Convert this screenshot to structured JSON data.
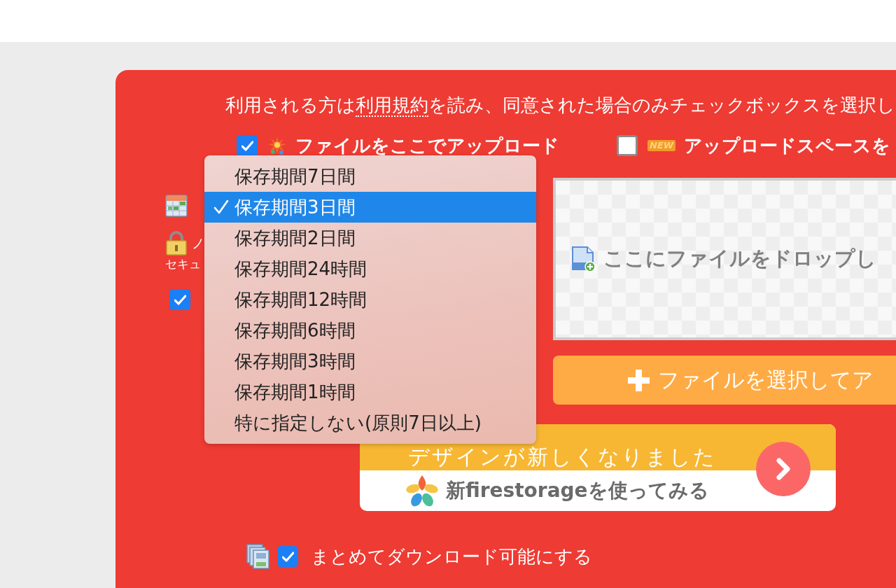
{
  "notice": {
    "before": "利用される方は",
    "link": "利用規約",
    "after": "を読み、同意された場合のみチェックボックスを選択し"
  },
  "upload_modes": [
    {
      "label": "ファイルをここでアップロード",
      "checked": true
    },
    {
      "label": "アップロードスペースを",
      "checked": false,
      "badge": "NEW"
    }
  ],
  "password": {
    "label": "ノ",
    "note": "セキュ"
  },
  "option_checkbox": {
    "checked": true
  },
  "retention_menu": {
    "options": [
      {
        "label": "保存期間7日間",
        "selected": false
      },
      {
        "label": "保存期間3日間",
        "selected": true
      },
      {
        "label": "保存期間2日間",
        "selected": false
      },
      {
        "label": "保存期間24時間",
        "selected": false
      },
      {
        "label": "保存期間12時間",
        "selected": false
      },
      {
        "label": "保存期間6時間",
        "selected": false
      },
      {
        "label": "保存期間3時間",
        "selected": false
      },
      {
        "label": "保存期間1時間",
        "selected": false
      },
      {
        "label": "特に指定しない(原則7日以上)",
        "selected": false
      }
    ]
  },
  "drop_zone": {
    "text": "ここにファイルをドロップし"
  },
  "select_button": {
    "label": "ファイルを選択してア"
  },
  "banner": {
    "headline": "デザインが新しくなりました",
    "text": "新firestorageを使ってみる"
  },
  "bulk_download": {
    "label": "まとめてダウンロード可能にする",
    "checked": true
  }
}
